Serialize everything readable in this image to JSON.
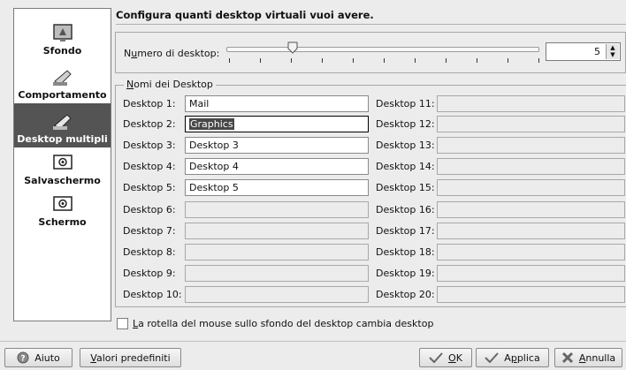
{
  "sidebar": {
    "items": [
      {
        "label": "Sfondo",
        "icon": "wallpaper-icon"
      },
      {
        "label": "Comportamento",
        "icon": "behavior-icon"
      },
      {
        "label": "Desktop multipli",
        "icon": "multiple-desktops-icon"
      },
      {
        "label": "Salvaschermo",
        "icon": "screensaver-icon"
      },
      {
        "label": "Schermo",
        "icon": "display-icon"
      }
    ],
    "active_index": 2
  },
  "header": {
    "title": "Configura quanti desktop virtuali vuoi avere."
  },
  "num_desktop": {
    "label_pre": "N",
    "label_u": "u",
    "label_post": "mero di desktop:",
    "value": "5",
    "slider_min": 1,
    "slider_max": 20
  },
  "names": {
    "legend_u": "N",
    "legend_rest": "omi dei Desktop",
    "left": [
      {
        "label": "Desktop 1:",
        "value": "Mail"
      },
      {
        "label": "Desktop 2:",
        "value": "Graphics"
      },
      {
        "label": "Desktop 3:",
        "value": "Desktop 3"
      },
      {
        "label": "Desktop 4:",
        "value": "Desktop 4"
      },
      {
        "label": "Desktop 5:",
        "value": "Desktop 5"
      },
      {
        "label": "Desktop 6:",
        "value": ""
      },
      {
        "label": "Desktop 7:",
        "value": ""
      },
      {
        "label": "Desktop 8:",
        "value": ""
      },
      {
        "label": "Desktop 9:",
        "value": ""
      },
      {
        "label": "Desktop 10:",
        "value": ""
      }
    ],
    "right": [
      {
        "label": "Desktop 11:",
        "value": ""
      },
      {
        "label": "Desktop 12:",
        "value": ""
      },
      {
        "label": "Desktop 13:",
        "value": ""
      },
      {
        "label": "Desktop 14:",
        "value": ""
      },
      {
        "label": "Desktop 15:",
        "value": ""
      },
      {
        "label": "Desktop 16:",
        "value": ""
      },
      {
        "label": "Desktop 17:",
        "value": ""
      },
      {
        "label": "Desktop 18:",
        "value": ""
      },
      {
        "label": "Desktop 19:",
        "value": ""
      },
      {
        "label": "Desktop 20:",
        "value": ""
      }
    ]
  },
  "wheel_option": {
    "u": "L",
    "rest": "a rotella del mouse sullo sfondo del desktop cambia desktop",
    "checked": false
  },
  "buttons": {
    "help": {
      "label": "Aiuto",
      "icon": "help-icon"
    },
    "defaults": {
      "u": "V",
      "rest": "alori predefiniti"
    },
    "ok": {
      "u": "O",
      "rest": "K",
      "icon": "check-icon"
    },
    "apply": {
      "pre": "A",
      "u": "p",
      "rest": "plica",
      "icon": "check-icon"
    },
    "cancel": {
      "u": "A",
      "rest": "nnulla",
      "icon": "cancel-icon"
    }
  }
}
